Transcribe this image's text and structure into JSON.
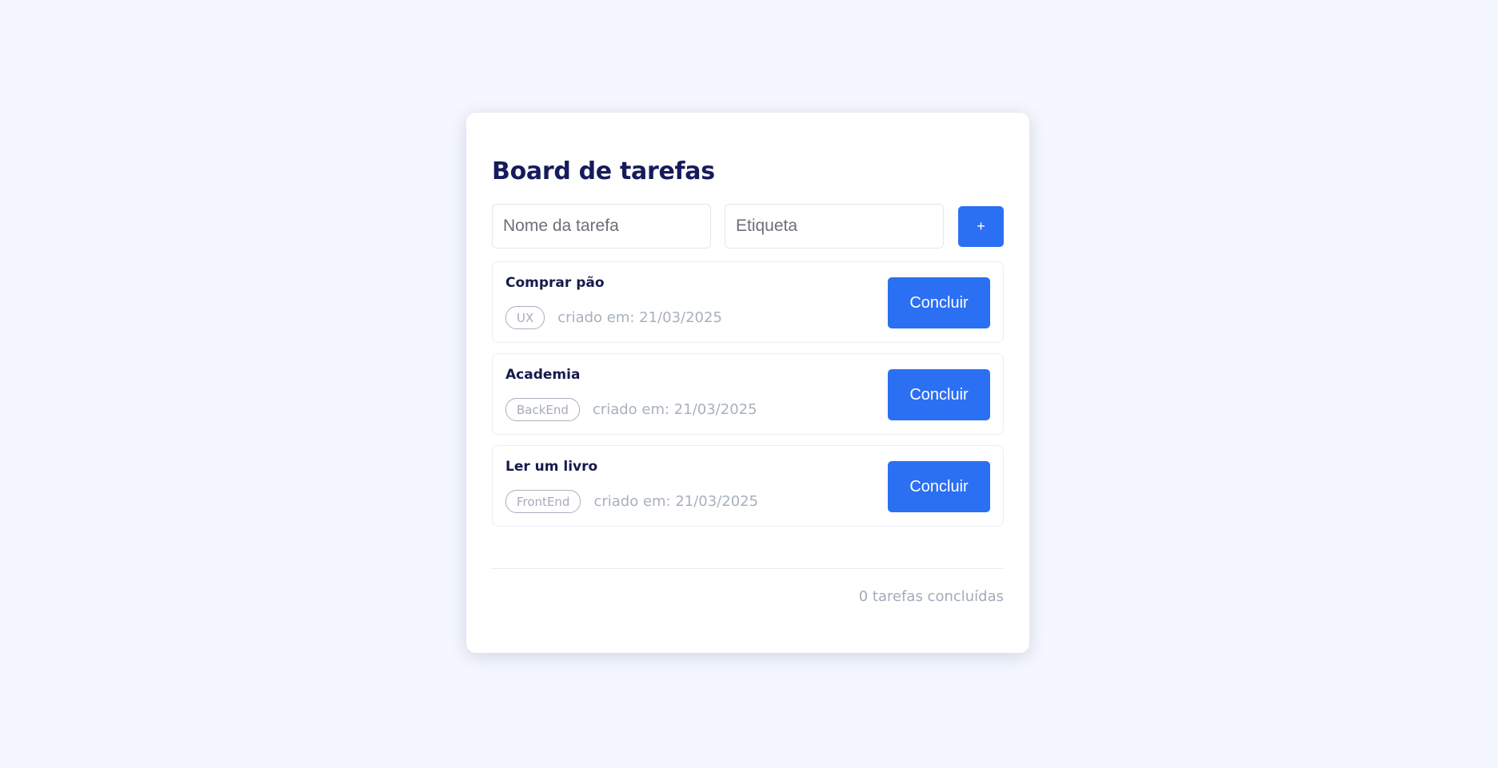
{
  "board": {
    "title": "Board de tarefas",
    "form": {
      "name_placeholder": "Nome da tarefa",
      "tag_placeholder": "Etiqueta",
      "add_label": "+"
    },
    "tasks": [
      {
        "name": "Comprar pão",
        "tag": "UX",
        "created": "criado em: 21/03/2025",
        "action": "Concluir"
      },
      {
        "name": "Academia",
        "tag": "BackEnd",
        "created": "criado em: 21/03/2025",
        "action": "Concluir"
      },
      {
        "name": "Ler um livro",
        "tag": "FrontEnd",
        "created": "criado em: 21/03/2025",
        "action": "Concluir"
      }
    ],
    "footer": {
      "completed_count": "0 tarefas concluídas"
    }
  },
  "colors": {
    "background": "#f4f7ff",
    "accent": "#2b6ff3",
    "title": "#161b5b",
    "muted": "#a8b0be"
  }
}
